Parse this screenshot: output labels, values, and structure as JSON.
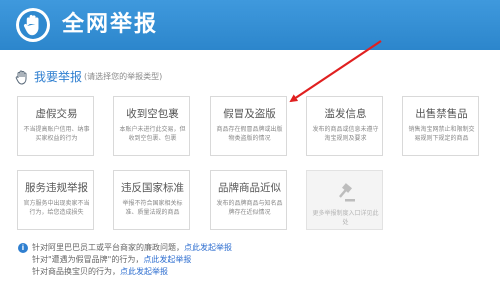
{
  "header": {
    "title": "全网举报",
    "logo_icon": "hand-shield-icon"
  },
  "section": {
    "title": "我要举报",
    "hint": "(请选择您的举报类型)",
    "icon": "hand-icon"
  },
  "cards": [
    {
      "title": "虚假交易",
      "desc": "不当提高账户信用、纳事买家权益的行为"
    },
    {
      "title": "收到空包裹",
      "desc": "本账户未进行此交易，但收到空包裹、包裹"
    },
    {
      "title": "假冒及盗版",
      "desc": "商品存在假冒品牌或出版物类盗版的情况"
    },
    {
      "title": "滥发信息",
      "desc": "发布的商品或信息未遵守淘宝规则及要求"
    },
    {
      "title": "出售禁售品",
      "desc": "销售淘宝网禁止和限制交易规则下规定的商品"
    },
    {
      "title": "服务违规举报",
      "desc": "官方服务中出现卖家不当行为，给您造成损失"
    },
    {
      "title": "违反国家标准",
      "desc": "举报不符合国家相关标准、质量法规的商品"
    },
    {
      "title": "品牌商品近似",
      "desc": "发布的品牌商品与知名品牌存在近似情况"
    },
    {
      "title": "",
      "desc": "更多举报制度入口详见此处",
      "icon": "gavel-icon",
      "disabled": true
    }
  ],
  "notes": [
    {
      "text": "针对阿里巴巴员工或平台商家的廉政问题，",
      "link": "点此发起举报"
    },
    {
      "text": "针对\"遭遇为假冒品牌\"的行为，",
      "link": "点此发起举报"
    },
    {
      "text": "针对商品换宝贝的行为，",
      "link": "点此发起举报"
    }
  ],
  "colors": {
    "banner": "#2f89cf",
    "link": "#2f6fd0",
    "arrow": "#e02020"
  }
}
